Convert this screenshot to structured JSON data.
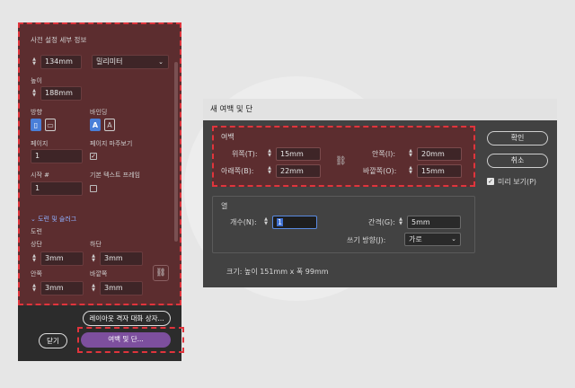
{
  "left_panel": {
    "section_title": "사전 설정 세부 정보",
    "width_value": "134mm",
    "unit_select": "밀리미터",
    "height_label": "높이",
    "height_value": "188mm",
    "orientation_label": "방향",
    "binding_label": "바인딩",
    "pages_label": "페이지",
    "pages_value": "1",
    "facing_pages_label": "페이지 마주보기",
    "facing_pages_check": "✓",
    "start_label": "시작 #",
    "start_value": "1",
    "primary_frame_label": "기본 텍스트 프레임",
    "bleed_slug_label": "도련 및 슬러그",
    "bleed_label": "도련",
    "top_label": "상단",
    "top_value": "3mm",
    "bottom_label": "하단",
    "bottom_value": "3mm",
    "inside_label": "안쪽",
    "inside_value": "3mm",
    "outside_label": "바깥쪽",
    "outside_value": "3mm",
    "layout_grid_button": "레이아웃 격자 대화 상자...",
    "close_button": "닫기",
    "margins_columns_button": "여백 및 단..."
  },
  "dialog": {
    "title": "새 여백 및 단",
    "margins_label": "여백",
    "top_label": "위쪽(T):",
    "top_value": "15mm",
    "bottom_label": "아래쪽(B):",
    "bottom_value": "22mm",
    "inside_label": "안쪽(I):",
    "inside_value": "20mm",
    "outside_label": "바깥쪽(O):",
    "outside_value": "15mm",
    "columns_label": "열",
    "number_label": "개수(N):",
    "number_value": "1",
    "gutter_label": "간격(G):",
    "gutter_value": "5mm",
    "writing_dir_label": "쓰기 방향(J):",
    "writing_dir_value": "가로",
    "size_text": "크기: 높이 151mm x 폭 99mm",
    "ok_button": "확인",
    "cancel_button": "취소",
    "preview_label": "미리 보기(P)",
    "preview_check": "✓"
  }
}
